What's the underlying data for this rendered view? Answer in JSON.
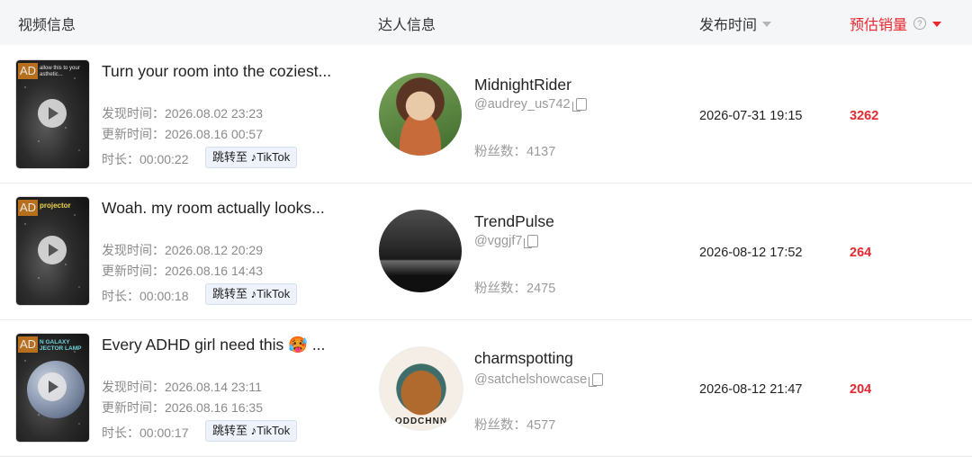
{
  "header": {
    "video_info": "视频信息",
    "creator_info": "达人信息",
    "publish_time": "发布时间",
    "estimated_sales": "预估销量",
    "help_glyph": "?"
  },
  "labels": {
    "ad": "AD",
    "discover": "发现时间：",
    "update": "更新时间：",
    "duration": "时长：",
    "jump_to": "跳转至",
    "tiktok": "TikTok",
    "tiktok_glyph": "♪",
    "fans": "粉丝数："
  },
  "accent_color": "#e8272f",
  "rows": [
    {
      "title": "Turn your room into the coziest...",
      "thumb_caption": "allow this to your asthetic...",
      "discover_time": "2026.08.02 23:23",
      "update_time": "2026.08.16 00:57",
      "duration": "00:00:22",
      "creator_name": "MidnightRider",
      "creator_handle": "@audrey_us742",
      "fans": "4137",
      "publish_time": "2026-07-31 19:15",
      "sales": "3262"
    },
    {
      "title": "Woah. my room actually looks...",
      "thumb_caption": "projector",
      "discover_time": "2026.08.12 20:29",
      "update_time": "2026.08.16 14:43",
      "duration": "00:00:18",
      "creator_name": "TrendPulse",
      "creator_handle": "@vggjf7",
      "fans": "2475",
      "publish_time": "2026-08-12 17:52",
      "sales": "264"
    },
    {
      "title": "Every ADHD girl need this 🥵 ...",
      "thumb_caption": "N GALAXY JECTOR LAMP",
      "discover_time": "2026.08.14 23:11",
      "update_time": "2026.08.16 16:35",
      "duration": "00:00:17",
      "creator_name": "charmspotting",
      "creator_handle": "@satchelshowcase",
      "avatar_text": "ODDCHNN",
      "fans": "4577",
      "publish_time": "2026-08-12 21:47",
      "sales": "204"
    }
  ]
}
